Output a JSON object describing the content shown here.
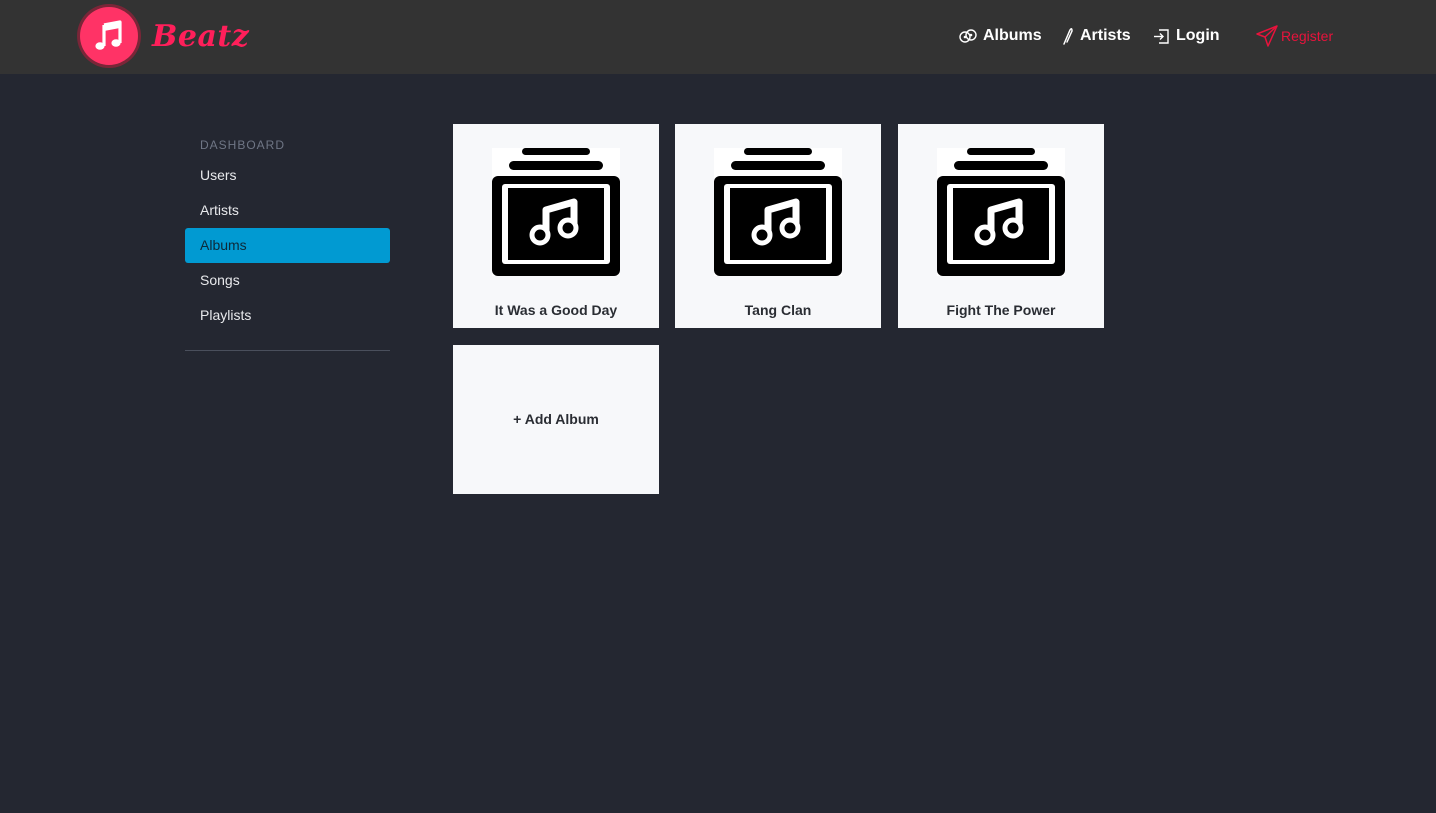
{
  "brand": {
    "name": "Beatz",
    "logo_icon": "music-note-icon",
    "color": "#ff1f5a"
  },
  "nav": {
    "albums": {
      "label": "Albums",
      "icon": "records-icon"
    },
    "artists": {
      "label": "Artists",
      "icon": "feather-icon"
    },
    "login": {
      "label": "Login",
      "icon": "login-icon"
    },
    "register": {
      "label": "Register",
      "icon": "paper-plane-icon",
      "color": "#e8133c"
    }
  },
  "sidebar": {
    "heading": "DASHBOARD",
    "items": [
      {
        "label": "Users",
        "active": false
      },
      {
        "label": "Artists",
        "active": false
      },
      {
        "label": "Albums",
        "active": true
      },
      {
        "label": "Songs",
        "active": false
      },
      {
        "label": "Playlists",
        "active": false
      }
    ],
    "active_color": "#019ad2"
  },
  "albums": [
    {
      "title": "It Was a Good Day",
      "art_icon": "album-stack-music-icon"
    },
    {
      "title": "Tang Clan",
      "art_icon": "album-stack-music-icon"
    },
    {
      "title": "Fight The Power",
      "art_icon": "album-stack-music-icon"
    }
  ],
  "add_album": {
    "label": "+ Add Album"
  }
}
